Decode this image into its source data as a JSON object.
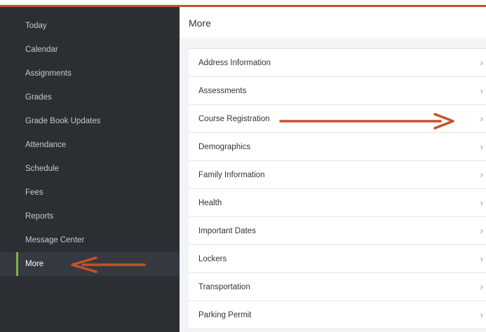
{
  "sidebar": {
    "items": [
      {
        "label": "Today"
      },
      {
        "label": "Calendar"
      },
      {
        "label": "Assignments"
      },
      {
        "label": "Grades"
      },
      {
        "label": "Grade Book Updates"
      },
      {
        "label": "Attendance"
      },
      {
        "label": "Schedule"
      },
      {
        "label": "Fees"
      },
      {
        "label": "Reports"
      },
      {
        "label": "Message Center"
      },
      {
        "label": "More"
      }
    ],
    "active": "More"
  },
  "main": {
    "title": "More",
    "items": [
      {
        "label": "Address Information"
      },
      {
        "label": "Assessments"
      },
      {
        "label": "Course Registration"
      },
      {
        "label": "Demographics"
      },
      {
        "label": "Family Information"
      },
      {
        "label": "Health"
      },
      {
        "label": "Important Dates"
      },
      {
        "label": "Lockers"
      },
      {
        "label": "Transportation"
      },
      {
        "label": "Parking Permit"
      }
    ]
  },
  "icons": {
    "chevron": "chevron-right-icon",
    "annotation": "arrow-annotation"
  },
  "colors": {
    "sidebar_bg": "#2b2f33",
    "accent": "#c8502c",
    "active_bar": "#7ab648",
    "arrow": "#c8502c"
  }
}
